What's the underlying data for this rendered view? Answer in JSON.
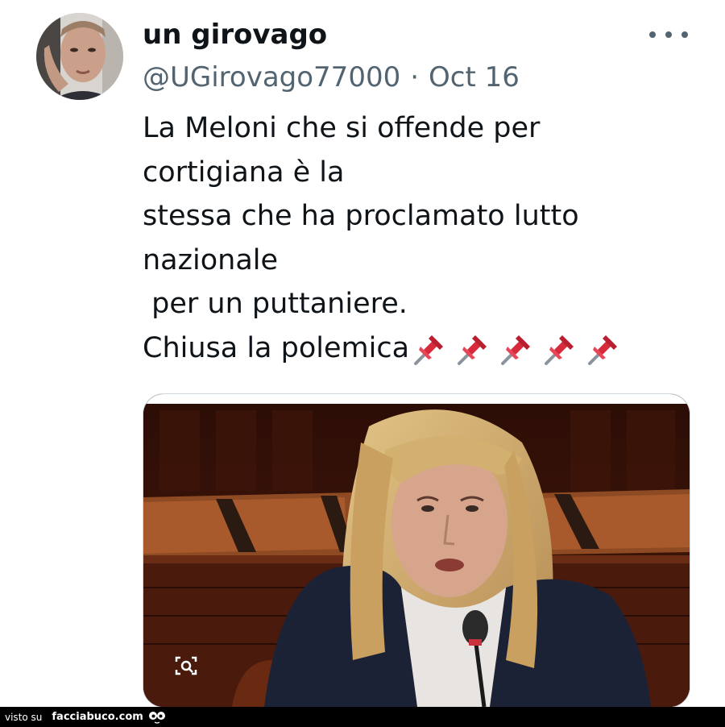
{
  "tweet": {
    "display_name": "un girovago",
    "handle": "@UGirovago77000",
    "separator": "·",
    "date": "Oct 16",
    "text": "La Meloni che si offende per\ncortigiana è la\nstessa che ha proclamato lutto\nnazionale\n per un puttaniere.\nChiusa la polemica",
    "trailing_icon": "pushpin-icon",
    "trailing_icon_count": 5,
    "media_type": "photo",
    "media_icon": "photo-viewer-icon",
    "more_icon": "more-options-icon"
  },
  "watermark": {
    "prefix": "visto su",
    "site": "facciabuco.com"
  },
  "colors": {
    "text_primary": "#0f1419",
    "text_secondary": "#536471",
    "pin_red": "#d72b3c",
    "watermark_bg": "#000000"
  }
}
